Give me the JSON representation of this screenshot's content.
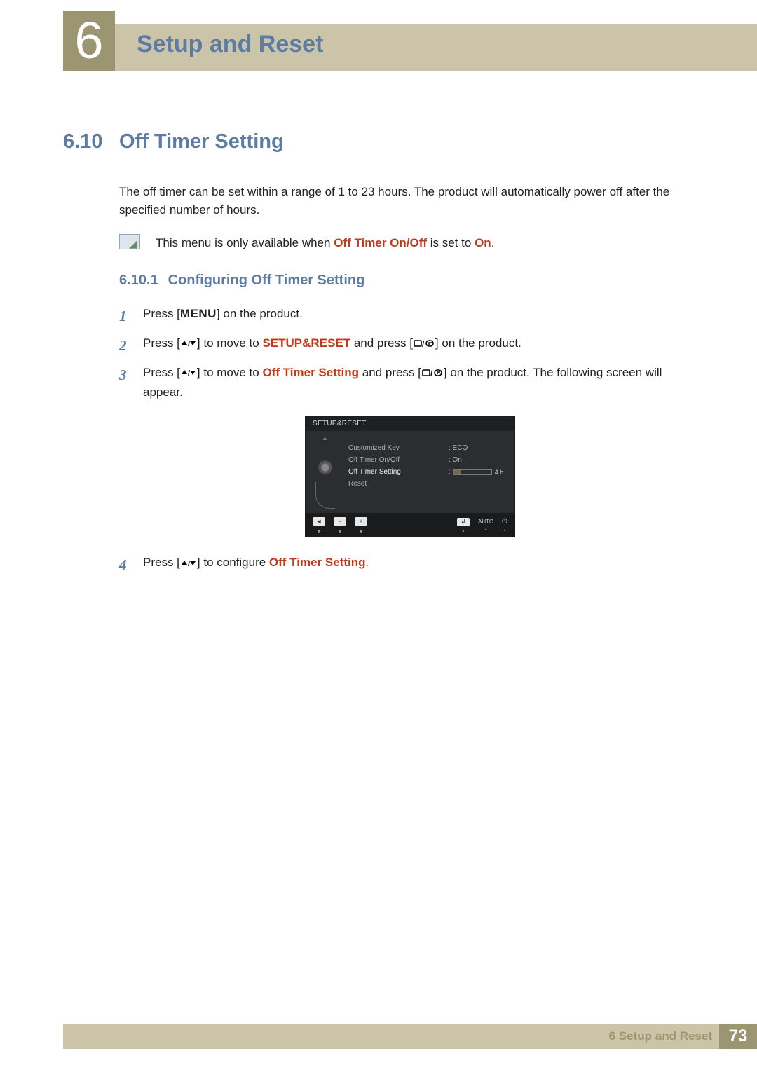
{
  "chapter": {
    "number": "6",
    "title": "Setup and Reset"
  },
  "section": {
    "number": "6.10",
    "title": "Off Timer Setting",
    "intro": "The off timer can be set within a range of 1 to 23 hours. The product will automatically power off after the specified number of hours.",
    "note_prefix": "This menu is only available when ",
    "note_bold1": "Off Timer On/Off",
    "note_mid": " is set to ",
    "note_bold2": "On",
    "note_suffix": "."
  },
  "subsection": {
    "number": "6.10.1",
    "title": "Configuring Off Timer Setting"
  },
  "steps": {
    "s1_a": "Press [",
    "s1_menu": "MENU",
    "s1_b": "] on the product.",
    "s2_a": "Press [",
    "s2_b": "] to move to ",
    "s2_bold": "SETUP&RESET",
    "s2_c": " and press [",
    "s2_d": "] on the product.",
    "s3_a": "Press [",
    "s3_b": "] to move to ",
    "s3_bold": "Off Timer Setting",
    "s3_c": " and press [",
    "s3_d": "] on the product. The following screen will appear.",
    "s4_a": "Press [",
    "s4_b": "] to configure ",
    "s4_bold": "Off Timer Setting",
    "s4_c": "."
  },
  "step_nums": {
    "n1": "1",
    "n2": "2",
    "n3": "3",
    "n4": "4"
  },
  "osd": {
    "title": "SETUP&RESET",
    "items": {
      "i1": "Customized Key",
      "i2": "Off Timer On/Off",
      "i3": "Off Timer Setting",
      "i4": "Reset"
    },
    "vals": {
      "v1": ": ECO",
      "v2": ": On",
      "v3_prefix": ":",
      "v3_label": "4 h"
    },
    "footer": {
      "auto": "AUTO"
    }
  },
  "footer": {
    "text": "6 Setup and Reset",
    "page": "73"
  }
}
